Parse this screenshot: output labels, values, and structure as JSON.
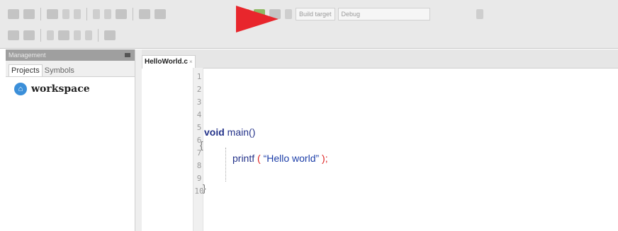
{
  "toolbar": {
    "row1_buttons": 14,
    "row2_buttons": 8,
    "field_build": "Build target",
    "field_config": "Debug",
    "annotation": {
      "type": "arrow",
      "color": "#e8262c"
    }
  },
  "sidebar": {
    "header": "Management",
    "tabs": [
      {
        "label": "Projects",
        "active": true
      },
      {
        "label": "Symbols",
        "active": false
      }
    ],
    "workspace": {
      "icon": "workspace-icon",
      "label": "workspace"
    }
  },
  "editor": {
    "tab_label": "HelloWorld.c",
    "tab_close": "×",
    "line_numbers": [
      "1",
      "2",
      "3",
      "4",
      "5",
      "6",
      "7",
      "8",
      "9",
      "10"
    ],
    "code": {
      "keyword": "void",
      "function": "main",
      "params": "()",
      "open_brace": "{",
      "call_name": "printf",
      "call_open": "(",
      "call_string": "“Hello world”",
      "call_close": ");",
      "close_brace": "}"
    }
  },
  "colors": {
    "keyword": "#24338a",
    "punctuation": "#dd2222",
    "string": "#1c3ea8",
    "arrow": "#e8262c"
  }
}
